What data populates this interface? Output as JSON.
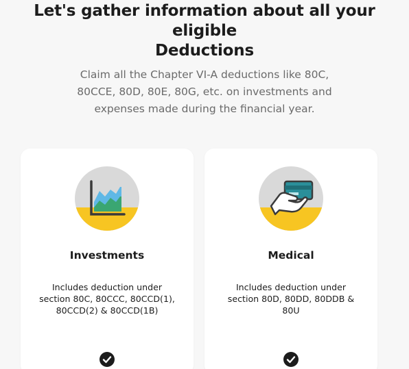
{
  "header": {
    "title_line1": "Let's gather information about all your eligible",
    "title_line2": "Deductions",
    "subtitle_line1": "Claim all the Chapter VI-A deductions like 80C,",
    "subtitle_line2": "80CCE, 80D, 80E, 80G, etc. on investments and",
    "subtitle_line3": "expenses made during the financial year."
  },
  "cards": [
    {
      "icon": "investment-chart-icon",
      "title": "Investments",
      "desc_line1": "Includes deduction under",
      "desc_line2": "section 80C, 80CCC, 80CCD(1),",
      "desc_line3": "80CCD(2) & 80CCD(1B)",
      "selected": true
    },
    {
      "icon": "card-payment-icon",
      "title": "Medical",
      "desc_line1": "Includes deduction under",
      "desc_line2": "section 80D, 80DD, 80DDB &",
      "desc_line3": "80U",
      "selected": true
    }
  ],
  "colors": {
    "accent_yellow": "#f7c522",
    "circle_grey": "#d9d9d9",
    "chart_blue": "#5fb8e6",
    "chart_green": "#3aa672",
    "card_teal": "#2a8f9a",
    "text_dark": "#1c1c1c"
  }
}
